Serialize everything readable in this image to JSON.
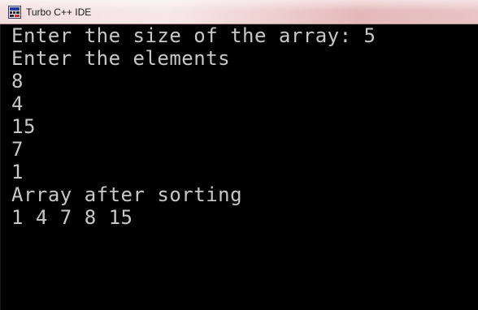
{
  "window": {
    "title": "Turbo C++ IDE",
    "icon": "turbo-cpp-app-icon"
  },
  "console": {
    "lines": [
      "Enter the size of the array: 5",
      "Enter the elements",
      "8",
      "4",
      "15",
      "7",
      "1",
      "Array after sorting",
      "1 4 7 8 15"
    ]
  },
  "colors": {
    "console_bg": "#000000",
    "console_text": "#c8c8c8"
  }
}
